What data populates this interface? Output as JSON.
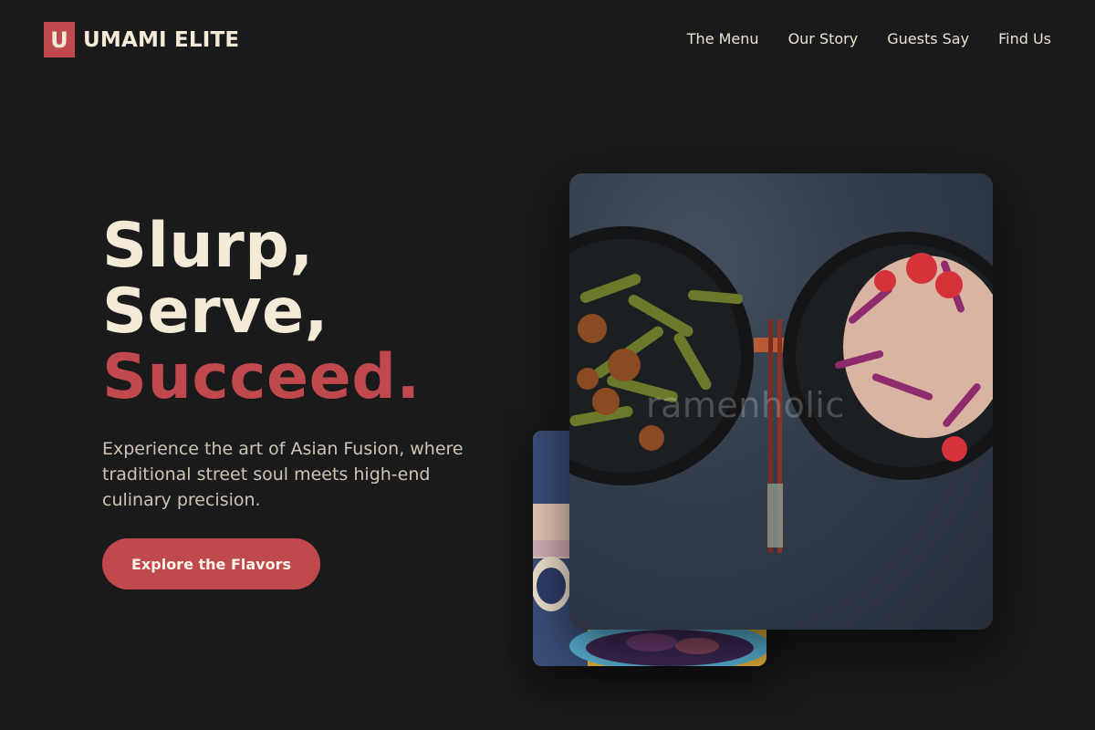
{
  "brand": {
    "mark": "U",
    "name": "UMAMI ELITE",
    "accent_color": "#c0494e"
  },
  "nav": {
    "items": [
      {
        "label": "The Menu"
      },
      {
        "label": "Our Story"
      },
      {
        "label": "Guests Say"
      },
      {
        "label": "Find Us"
      }
    ]
  },
  "hero": {
    "headline_line1": "Slurp,",
    "headline_line2": "Serve,",
    "headline_line3": "Succeed.",
    "subtitle": "Experience the art of Asian Fusion, where traditional street soul meets high-end culinary precision.",
    "cta_label": "Explore the Flavors"
  },
  "images": {
    "front": {
      "watermark": "ramenholic"
    }
  }
}
